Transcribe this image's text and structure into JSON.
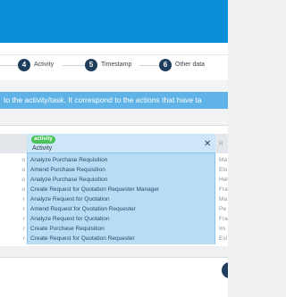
{
  "colors": {
    "header": "#0b8ed6",
    "banner": "#5fb3e6",
    "step_circle": "#1f3d5c",
    "activity_column": "#b9dcf6",
    "activity_tag": "#49c25a"
  },
  "wizard": {
    "steps": [
      {
        "number": "4",
        "label": "Activity"
      },
      {
        "number": "5",
        "label": "Timestamp"
      },
      {
        "number": "6",
        "label": "Other data"
      }
    ]
  },
  "banner": {
    "text": "to the activity/task. It correspond to the actions that have ta"
  },
  "table": {
    "activity_column": {
      "tag": "activity",
      "header": "Activity",
      "close_icon": "close-icon",
      "values": [
        "Analyze Purchase Requisition",
        "Amend Purchase Requisition",
        "Analyze Purchase Requisition",
        "Create Request for Quotation Requester Manager",
        "Analyze Request for Quotation",
        "Amend Request for Quotation Requester",
        "Analyze Request for Quotation",
        "Create Purchase Requisition",
        "Create Request for Quotation Requester"
      ]
    },
    "left_column_values": [
      "o",
      "o",
      "o",
      "o",
      "r",
      "r",
      "r",
      "r",
      "r"
    ],
    "right_column": {
      "header": "R",
      "values": [
        "Ma",
        "Elo",
        "Hel",
        "Fra",
        "Ma",
        "Pe",
        "Fra",
        "Im",
        "Esi"
      ]
    }
  }
}
